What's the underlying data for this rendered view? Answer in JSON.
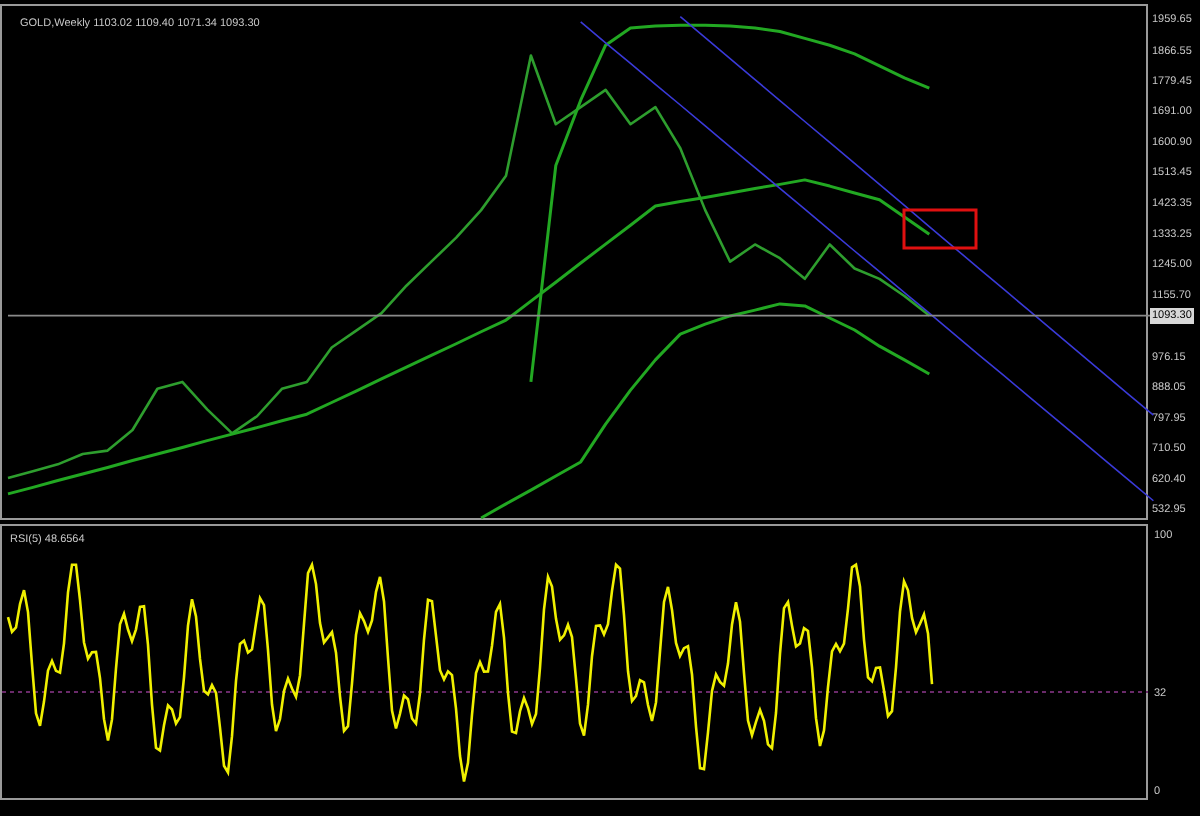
{
  "price_panel": {
    "header": "GOLD,Weekly 1103.02 1109.40 1071.34 1093.30",
    "current_price": "1093.30",
    "chart_data": {
      "type": "line",
      "ylim": [
        498,
        2000
      ],
      "yticks": [
        {
          "value": 1959.65,
          "label": "1959.65"
        },
        {
          "value": 1866.55,
          "label": "1866.55"
        },
        {
          "value": 1779.45,
          "label": "1779.45"
        },
        {
          "value": 1691.0,
          "label": "1691.00"
        },
        {
          "value": 1600.9,
          "label": "1600.90"
        },
        {
          "value": 1513.45,
          "label": "1513.45"
        },
        {
          "value": 1423.35,
          "label": "1423.35"
        },
        {
          "value": 1333.25,
          "label": "1333.25"
        },
        {
          "value": 1245.0,
          "label": "1245.00"
        },
        {
          "value": 1155.7,
          "label": "1155.70"
        },
        {
          "value": 976.15,
          "label": "976.15"
        },
        {
          "value": 888.05,
          "label": "888.05"
        },
        {
          "value": 797.95,
          "label": "797.95"
        },
        {
          "value": 710.5,
          "label": "710.50"
        },
        {
          "value": 620.4,
          "label": "620.40"
        },
        {
          "value": 532.95,
          "label": "532.95"
        }
      ],
      "series": [
        {
          "color": "#2e9e2e",
          "values": [
            620,
            640,
            660,
            690,
            700,
            760,
            880,
            900,
            820,
            750,
            800,
            880,
            900,
            1000,
            1050,
            1100,
            1180,
            1250,
            1320,
            1400,
            1500,
            1850,
            1650,
            1700,
            1750,
            1650,
            1700,
            1580,
            1400,
            1250,
            1300,
            1260,
            1200,
            1300,
            1230,
            1200,
            1150,
            1093,
            null,
            null,
            null,
            null,
            null,
            null,
            null,
            null,
            null
          ]
        },
        {
          "color": "#22a822",
          "values": [
            null,
            null,
            null,
            null,
            null,
            null,
            null,
            null,
            null,
            null,
            null,
            null,
            null,
            null,
            null,
            null,
            null,
            null,
            null,
            null,
            null,
            900,
            1530,
            1720,
            1880,
            1930,
            1936,
            1938,
            1938,
            1936,
            1930,
            1920,
            1900,
            1880,
            1855,
            1820,
            1785,
            1755,
            null,
            null,
            null,
            null,
            null,
            null,
            null,
            null,
            null
          ]
        },
        {
          "color": "#22a822",
          "values": [
            574,
            593,
            613,
            632,
            651,
            671,
            690,
            709,
            729,
            748,
            767,
            787,
            806,
            840,
            874,
            909,
            943,
            977,
            1011,
            1046,
            1080,
            1135,
            1190,
            1246,
            1301,
            1356,
            1412,
            1425,
            1437,
            1450,
            1463,
            1475,
            1488,
            1470,
            1450,
            1430,
            1380,
            1330,
            null,
            null,
            null,
            null,
            null,
            null,
            null,
            null,
            null
          ]
        },
        {
          "color": "#22a822",
          "values": [
            null,
            null,
            null,
            null,
            null,
            null,
            null,
            null,
            null,
            null,
            null,
            null,
            null,
            null,
            null,
            null,
            null,
            null,
            null,
            504,
            545,
            585,
            626,
            667,
            777,
            876,
            964,
            1039,
            1068,
            1092,
            1109,
            1127,
            1121,
            1086,
            1051,
            1004,
            964,
            923,
            null,
            null,
            null,
            null,
            null,
            null,
            null,
            null,
            null
          ]
        },
        {
          "color": "#3a3ad8",
          "values": [
            null,
            null,
            null,
            null,
            null,
            null,
            null,
            null,
            null,
            null,
            null,
            null,
            null,
            null,
            null,
            null,
            null,
            null,
            null,
            null,
            null,
            null,
            null,
            1948,
            1887,
            1827,
            1766,
            1706,
            1645,
            1584,
            1524,
            1463,
            1403,
            1342,
            1281,
            1221,
            1160,
            1100,
            1039,
            978,
            918,
            857,
            797,
            736,
            675,
            615,
            554
          ]
        },
        {
          "color": "#3a3ad8",
          "values": [
            null,
            null,
            null,
            null,
            null,
            null,
            null,
            null,
            null,
            null,
            null,
            null,
            null,
            null,
            null,
            null,
            null,
            null,
            null,
            null,
            null,
            null,
            null,
            null,
            null,
            null,
            null,
            1963,
            1902,
            1841,
            1780,
            1719,
            1658,
            1597,
            1536,
            1475,
            1414,
            1352,
            1291,
            1230,
            1169,
            1108,
            1047,
            986,
            925,
            864,
            803
          ]
        },
        {
          "color": "#8a8a8a",
          "values": [
            1093,
            1093,
            1093,
            1093,
            1093,
            1093,
            1093,
            1093,
            1093,
            1093,
            1093,
            1093,
            1093,
            1093,
            1093,
            1093,
            1093,
            1093,
            1093,
            1093,
            1093,
            1093,
            1093,
            1093,
            1093,
            1093,
            1093,
            1093,
            1093,
            1093,
            1093,
            1093,
            1093,
            1093,
            1093,
            1093,
            1093,
            1093,
            1093,
            1093,
            1093,
            1093,
            1093,
            1093,
            1093,
            1093,
            1093
          ]
        }
      ]
    }
  },
  "rsi_panel": {
    "label": "RSI(5) 48.6564",
    "levels": [
      "100",
      "32",
      "0"
    ]
  }
}
